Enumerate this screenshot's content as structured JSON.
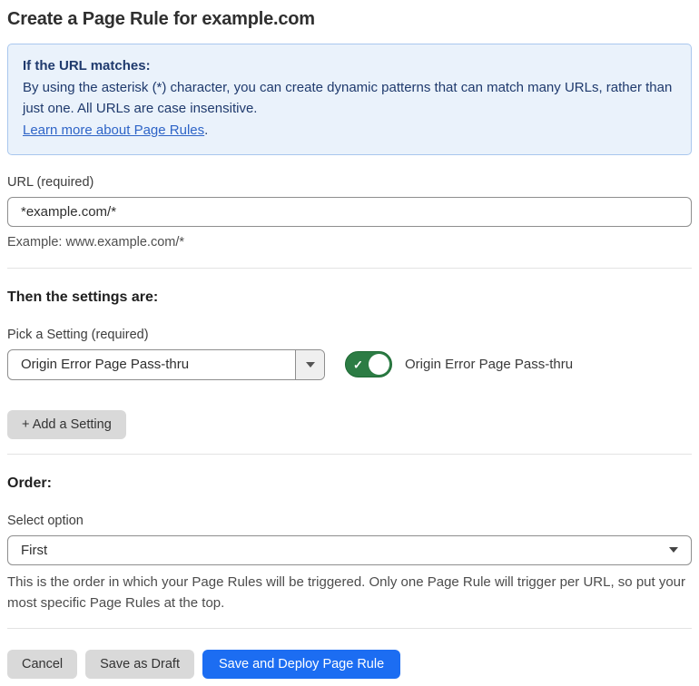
{
  "page": {
    "title": "Create a Page Rule for example.com"
  },
  "info_box": {
    "heading": "If the URL matches:",
    "body": "By using the asterisk (*) character, you can create dynamic patterns that can match many URLs, rather than just one. All URLs are case insensitive.",
    "link_label": "Learn more about Page Rules",
    "link_suffix": "."
  },
  "url_field": {
    "label": "URL (required)",
    "value": "*example.com/*",
    "helper": "Example: www.example.com/*"
  },
  "settings_section": {
    "heading": "Then the settings are:",
    "picker_label": "Pick a Setting (required)",
    "picker_value": "Origin Error Page Pass-thru",
    "toggle_label": "Origin Error Page Pass-thru",
    "toggle_state": "on",
    "toggle_check_glyph": "✓",
    "add_setting_label": "+ Add a Setting"
  },
  "order_section": {
    "heading": "Order:",
    "select_label": "Select option",
    "select_value": "First",
    "helper": "This is the order in which your Page Rules will be triggered. Only one Page Rule will trigger per URL, so put your most specific Page Rules at the top."
  },
  "footer": {
    "cancel_label": "Cancel",
    "save_draft_label": "Save as Draft",
    "save_deploy_label": "Save and Deploy Page Rule"
  },
  "icons": {
    "picker_dropdown": "chevron-down-icon",
    "order_dropdown": "chevron-down-icon",
    "toggle_check": "check-icon"
  },
  "colors": {
    "info_bg": "#eaf2fb",
    "info_border": "#a9c7ee",
    "info_text": "#1f3a6d",
    "link": "#2e64c7",
    "toggle_on": "#2c7c44",
    "toggle_border": "#1e6a34",
    "primary_button": "#1c6df2",
    "secondary_button": "#d9d9d9",
    "field_border": "#8e8e8e",
    "divider": "#e3e3e3"
  }
}
